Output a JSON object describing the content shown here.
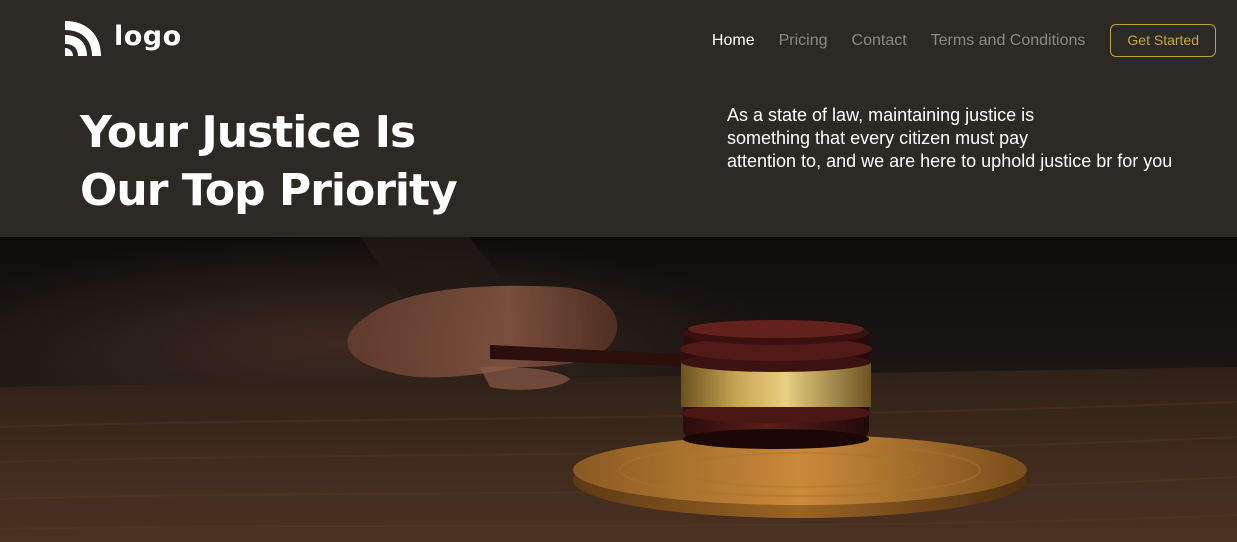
{
  "header": {
    "logo": {
      "icon": "wifi-arcs-logo-icon",
      "text": "logo"
    },
    "nav": [
      {
        "label": "Home",
        "active": true
      },
      {
        "label": "Pricing",
        "active": false
      },
      {
        "label": "Contact",
        "active": false
      },
      {
        "label": "Terms and Conditions",
        "active": false
      }
    ],
    "cta_label": "Get Started"
  },
  "hero": {
    "headline_lines": [
      "Your Justice Is",
      "Our Top Priority"
    ],
    "intro_lines": [
      "As a state of law, maintaining justice is",
      "something that every citizen must pay",
      "attention to, and we are here to uphold justice br for you"
    ],
    "image": {
      "subject": "judge-gavel-on-sound-block-photo"
    }
  },
  "colors": {
    "background": "#2c2a24",
    "accent_gold": "#c7a54a",
    "text_primary": "#ffffff",
    "text_muted": "#8b8a86"
  }
}
